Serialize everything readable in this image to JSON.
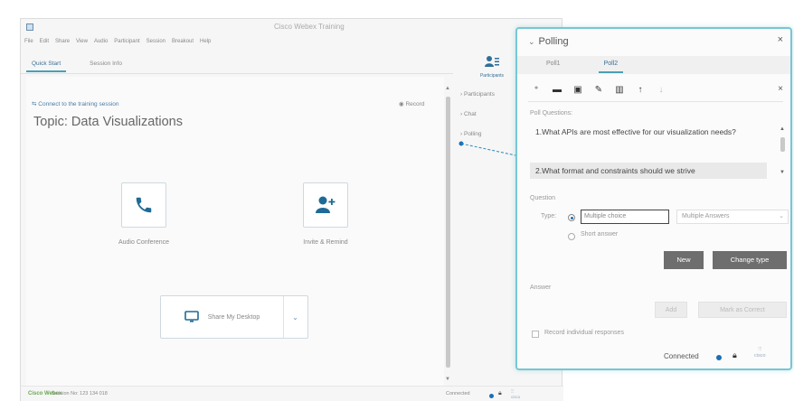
{
  "window": {
    "title": "Cisco Webex Training",
    "menu": [
      "File",
      "Edit",
      "Share",
      "View",
      "Audio",
      "Participant",
      "Session",
      "Breakout",
      "Help"
    ],
    "tabs": [
      {
        "label": "Quick Start",
        "active": true
      },
      {
        "label": "Session Info",
        "active": false
      }
    ]
  },
  "meeting": {
    "connect_link": "Connect to the training session",
    "record_label": "Record",
    "topic": "Topic: Data Visualizations",
    "actions": [
      {
        "label": "Audio Conference",
        "icon": "phone-icon"
      },
      {
        "label": "Invite & Remind",
        "icon": "add-user-icon"
      }
    ],
    "share_label": "Share My Desktop"
  },
  "participants_button": {
    "label": "Participants"
  },
  "side_panels": [
    {
      "label": "Participants",
      "active": false
    },
    {
      "label": "Chat",
      "active": false
    },
    {
      "label": "Polling",
      "active": true
    }
  ],
  "statusbar": {
    "logo_text": "Cisco Webex",
    "session_number": "Session No: 123 134 018",
    "connected": "Connected",
    "cisco": "cisco"
  },
  "polling": {
    "title": "Polling",
    "tabs": [
      {
        "label": "Poll1",
        "active": false
      },
      {
        "label": "Poll2",
        "active": true
      }
    ],
    "questions_label": "Poll Questions:",
    "questions": [
      "1.What APIs are most effective for our visualization needs?",
      "2.What format and constraints should we strive"
    ],
    "question_section_label": "Question",
    "type_label": "Type:",
    "type_options": {
      "multiple": "Multiple choice",
      "short": "Short answer"
    },
    "answer_mode": "Multiple Answers",
    "new_label": "New",
    "change_type_label": "Change type",
    "answer_label": "Answer",
    "add_label": "Add",
    "mark_correct_label": "Mark as Correct",
    "record_label": "Record individual responses",
    "connected": "Connected",
    "cisco": "cisco"
  },
  "colors": {
    "accent": "#4aa0b5",
    "link": "#3a6f93",
    "panel_border": "#76c7d3",
    "status_dot": "#1b6fb3"
  }
}
